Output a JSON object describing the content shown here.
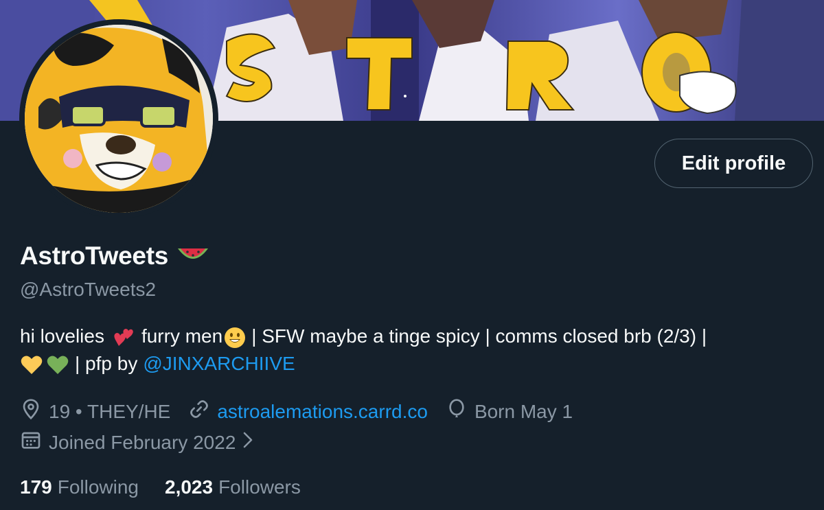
{
  "profile": {
    "edit_button": "Edit profile",
    "display_name": "AstroTweets",
    "name_emoji_icon": "watermelon-icon",
    "handle": "@AstroTweets2",
    "bio": {
      "line1_a": "hi lovelies",
      "line1_b": "furry men",
      "line1_c": "| SFW maybe a tinge spicy | comms closed brb (2/3) |",
      "line2_a": "| pfp by",
      "mention": "@JINXARCHIIVE"
    },
    "meta": {
      "location": "19 • THEY/HE",
      "website": "astroalemations.carrd.co",
      "birthday": "Born May 1",
      "joined": "Joined February 2022"
    },
    "stats": {
      "following_count": "179",
      "following_label": "Following",
      "followers_count": "2,023",
      "followers_label": "Followers"
    }
  },
  "colors": {
    "background": "#15202b",
    "text_primary": "#f7f9f9",
    "text_secondary": "#8b98a5",
    "link": "#1d9bf0",
    "border": "#536471"
  }
}
